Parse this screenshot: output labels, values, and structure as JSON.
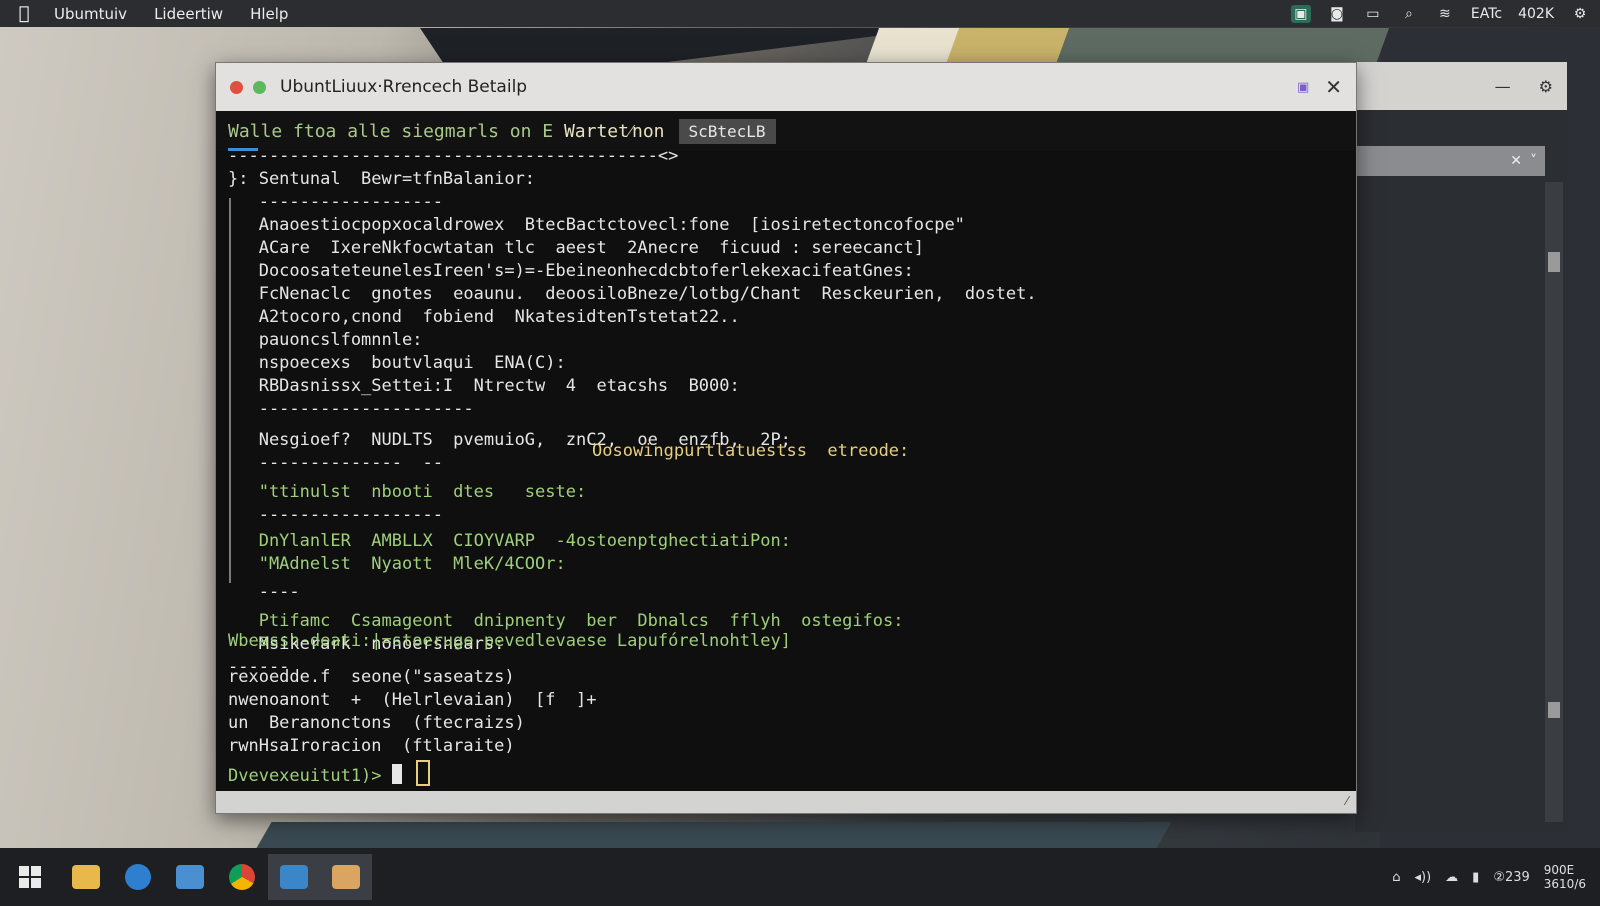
{
  "topbar": {
    "menu": [
      "Ubumtuiv",
      "Lideertiw",
      "Hlelp"
    ],
    "status_text_1": "EATc",
    "status_text_2": "402K"
  },
  "window": {
    "title": "UbuntLiuux·Rrencech Betailp",
    "tab_title_green": "Walle ftoa alle siegmarls on E ",
    "tab_title_yellow": "Wartet⁄non",
    "tab_badge": "ScBtecLB"
  },
  "terminal": {
    "dash_line": "------------------------------------------<>",
    "lines": [
      {
        "text": "}: Sentunal  Bewr=tfnBalanior:",
        "cls": "w"
      },
      {
        "text": "   ------------------",
        "cls": "w"
      },
      {
        "text": "   Anaoestiocpopxocaldrowex  BtecBactctovecl:fone  [iosiretectoncofocpe\"",
        "cls": "w"
      },
      {
        "text": "   ACare  IxereNkfocwtatan tlc  aeest  2Anecre  ficuud : sereecanct]",
        "cls": "w"
      },
      {
        "text": "   DocoosateteunelesIreen's=)=-EbeineonhecdcbtoferlekexacifeatGnes:",
        "cls": "w"
      },
      {
        "text": "   FcNenaclc  gnotes  eoaunu.  deoosiloBneze/lotbg/Chant  Resckeurien,  dostet.",
        "cls": "w"
      },
      {
        "text": "   A2tocoro,cnond  fobiend  NkatesidtenTstetat22..",
        "cls": "w"
      },
      {
        "text": "   pauoncslfomnnle:",
        "cls": "w"
      },
      {
        "text": "   nspoecexs  boutvlaqui  ENA(C):",
        "cls": "w"
      },
      {
        "text": "   RBDasnissx_Settei:I  Ntrectw  4  etacshs  B000:",
        "cls": "w"
      },
      {
        "text": "   ---------------------",
        "cls": "w"
      },
      {
        "text": "   Nesgioef?  NUDLTS  pvemuioG,  znC2,  oe  enzfb,  2P;",
        "cls": "w"
      },
      {
        "text": "   --------------  --",
        "cls": "w"
      },
      {
        "text": "   \"ttinulst  nbooti  dtes   seste:",
        "cls": "g"
      },
      {
        "text": "   ------------------",
        "cls": "w"
      },
      {
        "text": "   DnYlanlER  AMBLLX  CIOYVARP  -4ostoenptghectiatiPon:",
        "cls": "g"
      },
      {
        "text": "   \"MAdnelst  Nyaott  MleK/4COOr:",
        "cls": "g"
      },
      {
        "text": "   ----",
        "cls": "w"
      },
      {
        "text": "   Ptifamc  Csamageont  dnipnenty  ber  Dbnalcs  fflyh  ostegifos:",
        "cls": "g"
      },
      {
        "text": "   Msikerark  nonoersnears:",
        "cls": "w"
      },
      {
        "text": "------",
        "cls": "w"
      }
    ],
    "inline_note": "Oosowingpurtlatuestss  etreode:",
    "prompt_line": "Wbeassh-deati:|=stoeruge pevedlevaese Lapufórelnohtley]",
    "cmd_lines": [
      "rexoedde.f  seone(\"saseatzs)",
      "nwenoanont  +  (Helrlevaian)  [f  ]+",
      "un  Beranonctons  (ftecraizs)",
      "rwnHsaIroracion  (ftlaraite)"
    ],
    "final_prompt": "Dvevexeuitut1)>"
  },
  "taskbar": {
    "clock_time": "900E",
    "clock_date": "3610/6",
    "tray_text": "②239"
  },
  "colors": {
    "accent_green": "#9fcf7a",
    "accent_yellow": "#e8cf7a",
    "terminal_bg": "#0f0f0f",
    "tab_underline": "#3b8fd6"
  }
}
